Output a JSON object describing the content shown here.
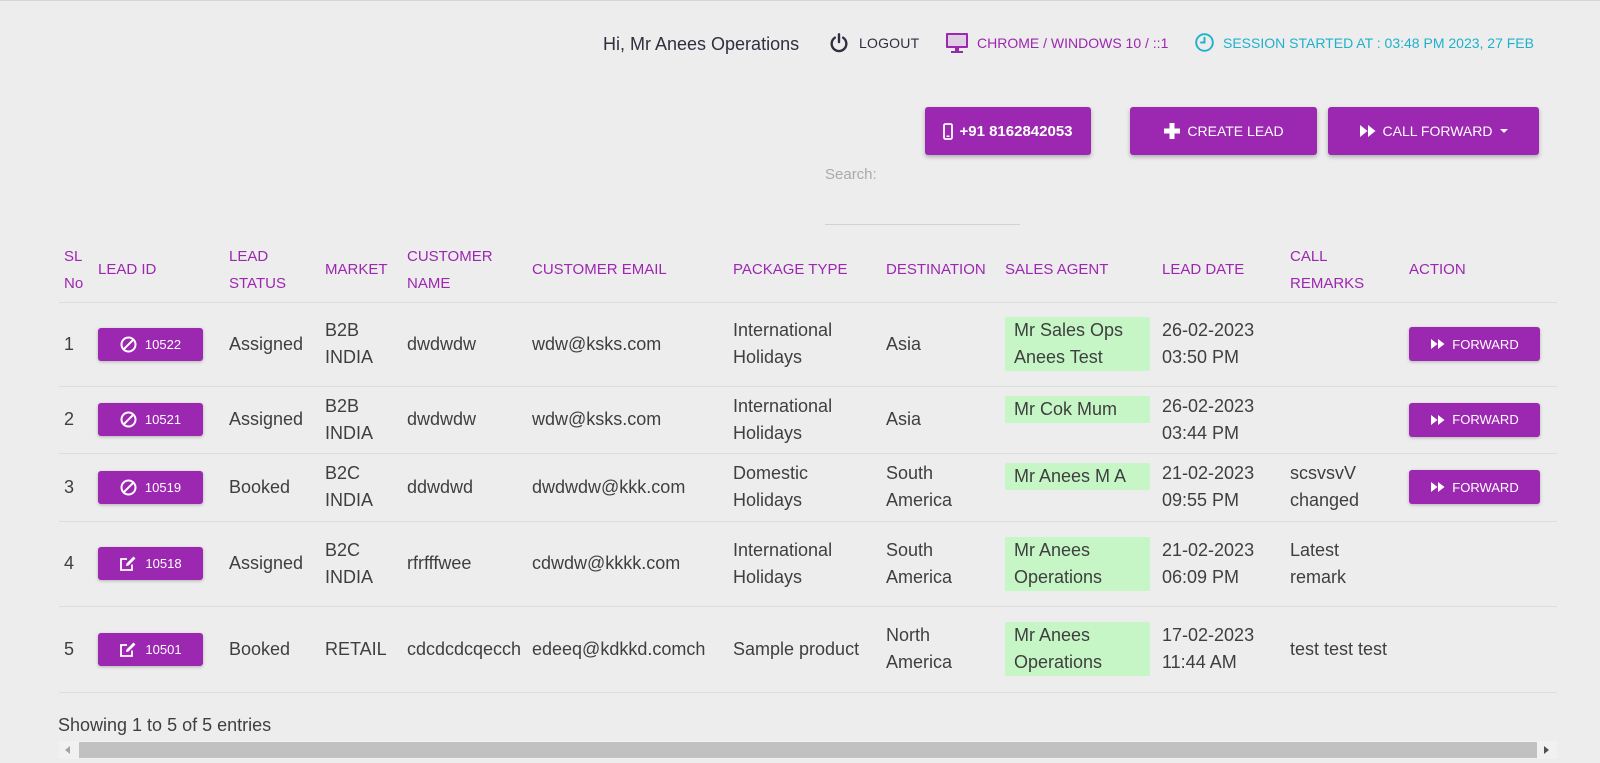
{
  "header": {
    "greeting": "Hi, Mr Anees Operations",
    "logout": "LOGOUT",
    "browser": "CHROME / WINDOWS 10 / ::1",
    "session": "SESSION STARTED AT : 03:48 PM 2023, 27 FEB"
  },
  "buttons": {
    "phone": "+91 8162842053",
    "create": "CREATE LEAD",
    "forward": "CALL FORWARD"
  },
  "search": {
    "label": "Search:",
    "value": ""
  },
  "table": {
    "columns": [
      "SL No",
      "LEAD ID",
      "LEAD STATUS",
      "MARKET",
      "CUSTOMER NAME",
      "CUSTOMER EMAIL",
      "PACKAGE TYPE",
      "DESTINATION",
      "SALES AGENT",
      "LEAD DATE",
      "CALL REMARKS",
      "ACTION"
    ],
    "rows": [
      {
        "sl": "1",
        "lead_id": "10522",
        "lead_icon": "ban-icon",
        "status": "Assigned",
        "market": "B2B INDIA",
        "name": "dwdwdw",
        "email": "wdw@ksks.com",
        "package": "International Holidays",
        "destination": "Asia",
        "agent": "Mr Sales Ops Anees Test",
        "date": "26-02-2023 03:50 PM",
        "remarks": "",
        "action": "FORWARD"
      },
      {
        "sl": "2",
        "lead_id": "10521",
        "lead_icon": "ban-icon",
        "status": "Assigned",
        "market": "B2B INDIA",
        "name": "dwdwdw",
        "email": "wdw@ksks.com",
        "package": "International Holidays",
        "destination": "Asia",
        "agent": "Mr Cok Mum",
        "date": "26-02-2023 03:44 PM",
        "remarks": "",
        "action": "FORWARD"
      },
      {
        "sl": "3",
        "lead_id": "10519",
        "lead_icon": "ban-icon",
        "status": "Booked",
        "market": "B2C INDIA",
        "name": "ddwdwd",
        "email": "dwdwdw@kkk.com",
        "package": "Domestic Holidays",
        "destination": "South America",
        "agent": "Mr Anees M A",
        "date": "21-02-2023 09:55 PM",
        "remarks": "scsvsvV changed",
        "action": "FORWARD"
      },
      {
        "sl": "4",
        "lead_id": "10518",
        "lead_icon": "edit-icon",
        "status": "Assigned",
        "market": "B2C INDIA",
        "name": "rfrfffwee",
        "email": "cdwdw@kkkk.com",
        "package": "International Holidays",
        "destination": "South America",
        "agent": "Mr Anees Operations",
        "date": "21-02-2023 06:09 PM",
        "remarks": "Latest remark",
        "action": ""
      },
      {
        "sl": "5",
        "lead_id": "10501",
        "lead_icon": "edit-icon",
        "status": "Booked",
        "market": "RETAIL",
        "name": "cdcdcdcqecch",
        "email": "edeeq@kdkkd.comch",
        "package": "Sample product",
        "destination": "North America",
        "agent": "Mr Anees Operations",
        "date": "17-02-2023 11:44 AM",
        "remarks": "test test test",
        "action": ""
      }
    ]
  },
  "footer": {
    "info": "Showing 1 to 5 of 5 entries"
  },
  "colors": {
    "accent": "#9c27b0",
    "session": "#1eb1cc",
    "agent_bg": "#c6f6c6",
    "background": "#ededed"
  }
}
